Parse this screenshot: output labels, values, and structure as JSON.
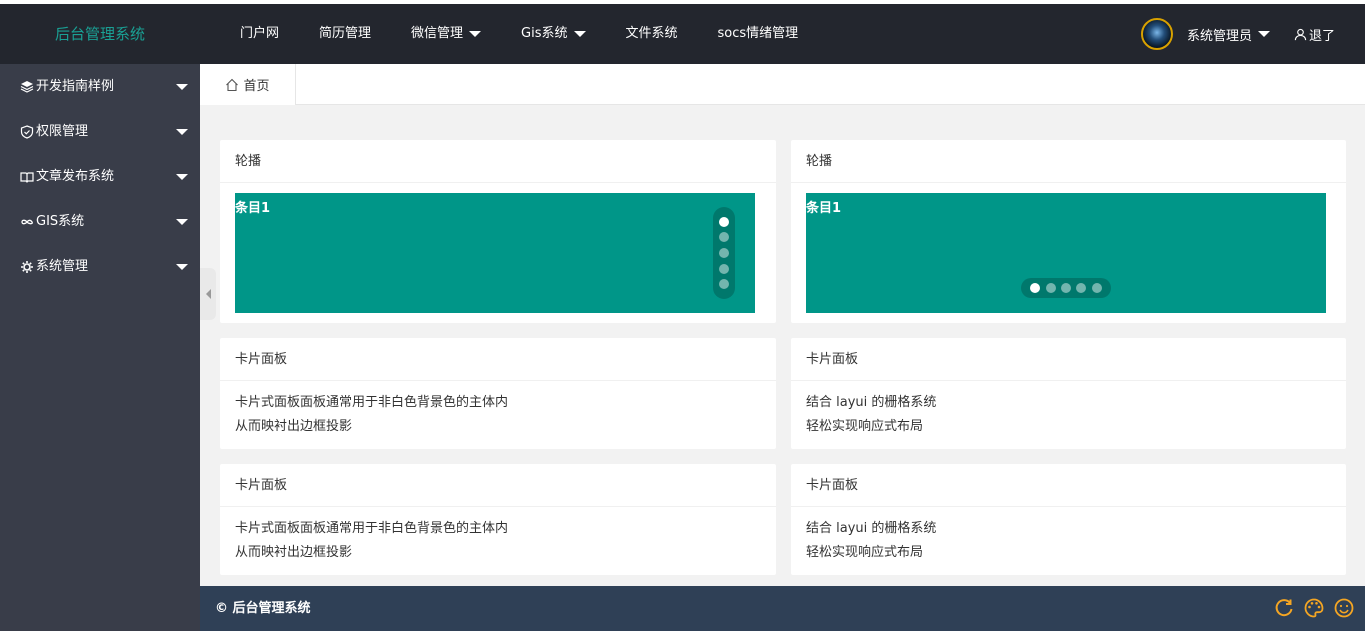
{
  "header": {
    "logo": "后台管理系统",
    "nav": [
      {
        "label": "门户网",
        "dropdown": false
      },
      {
        "label": "简历管理",
        "dropdown": false
      },
      {
        "label": "微信管理",
        "dropdown": true
      },
      {
        "label": "Gis系统",
        "dropdown": true
      },
      {
        "label": "文件系统",
        "dropdown": false
      },
      {
        "label": "socs情绪管理",
        "dropdown": false
      }
    ],
    "user": "系统管理员",
    "logout": "退了"
  },
  "sidebar": {
    "items": [
      {
        "label": "开发指南样例",
        "icon": "layers-icon"
      },
      {
        "label": "权限管理",
        "icon": "shield-icon"
      },
      {
        "label": "文章发布系统",
        "icon": "book-icon"
      },
      {
        "label": "GIS系统",
        "icon": "infinity-icon"
      },
      {
        "label": "系统管理",
        "icon": "gear-icon"
      }
    ]
  },
  "tabs": {
    "home": "首页"
  },
  "cards": {
    "carousel1": {
      "title": "轮播",
      "item": "条目1"
    },
    "carousel2": {
      "title": "轮播",
      "item": "条目1"
    },
    "card1": {
      "title": "卡片面板",
      "line1": "卡片式面板面板通常用于非白色背景色的主体内",
      "line2": "从而映衬出边框投影"
    },
    "card2": {
      "title": "卡片面板",
      "line1": "结合 layui 的栅格系统",
      "line2": "轻松实现响应式布局"
    },
    "card3": {
      "title": "卡片面板",
      "line1": "卡片式面板面板通常用于非白色背景色的主体内",
      "line2": "从而映衬出边框投影"
    },
    "card4": {
      "title": "卡片面板",
      "line1": "结合 layui 的栅格系统",
      "line2": "轻松实现响应式布局"
    }
  },
  "footer": {
    "text": "© 后台管理系统"
  },
  "colors": {
    "header_bg": "#23262e",
    "sidebar_bg": "#393d49",
    "logo": "#1aa094",
    "carousel": "#009688",
    "footer_bg": "#2f4056",
    "footer_icons": "#f5a623"
  }
}
